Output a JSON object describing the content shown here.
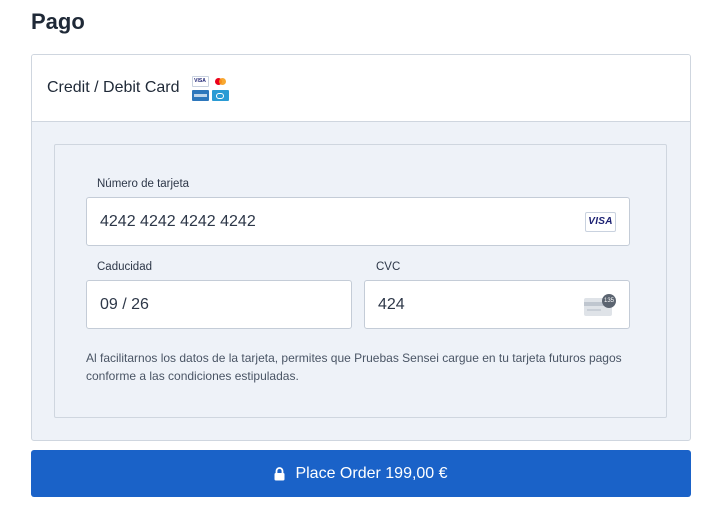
{
  "page": {
    "title": "Pago"
  },
  "payment_method": {
    "label": "Credit / Debit Card",
    "logos": [
      "visa-logo",
      "mastercard-logo",
      "amex-logo",
      "diners-logo"
    ]
  },
  "card_form": {
    "card_number": {
      "label": "Número de tarjeta",
      "value": "4242 4242 4242 4242",
      "brand": "VISA"
    },
    "expiry": {
      "label": "Caducidad",
      "value": "09 / 26"
    },
    "cvc": {
      "label": "CVC",
      "value": "424",
      "icon_badge": "135"
    },
    "disclaimer": "Al facilitarnos los datos de la tarjeta, permites que Pruebas Sensei cargue en tu tarjeta futuros pagos conforme a las condiciones estipuladas."
  },
  "actions": {
    "place_order_label": "Place Order 199,00 €"
  },
  "colors": {
    "primary": "#1a62c8",
    "panel_bg": "#eef2f8",
    "border": "#cfd6df"
  }
}
